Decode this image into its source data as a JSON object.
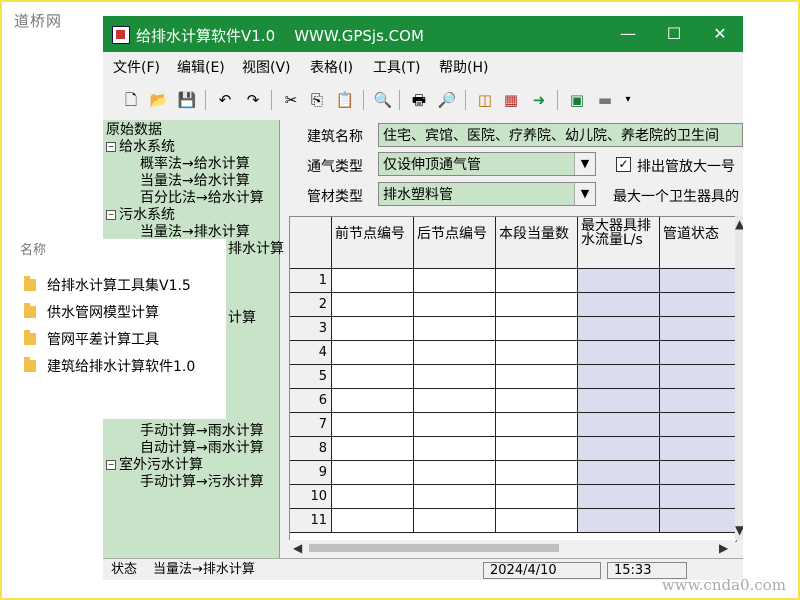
{
  "watermarks": {
    "top_left": "道桥网",
    "bottom_right": "www.cnda0.com"
  },
  "window": {
    "title": "给排水计算软件V1.0    WWW.GPSjs.COM",
    "minimize_glyph": "—",
    "maximize_glyph": "☐",
    "close_glyph": "✕"
  },
  "menu": [
    "文件(F)",
    "编辑(E)",
    "视图(V)",
    "表格(I)",
    "工具(T)",
    "帮助(H)"
  ],
  "toolbar": [
    {
      "icon": "new-file-icon",
      "glyph": "🗋"
    },
    {
      "icon": "open-folder-icon",
      "glyph": "📂"
    },
    {
      "icon": "save-icon",
      "glyph": "💾"
    },
    {
      "icon": "undo-icon",
      "glyph": "↶"
    },
    {
      "icon": "redo-icon",
      "glyph": "↷"
    },
    {
      "icon": "cut-icon",
      "glyph": "✂"
    },
    {
      "icon": "copy-icon",
      "glyph": "⎘"
    },
    {
      "icon": "paste-icon",
      "glyph": "📋"
    },
    {
      "icon": "find-icon",
      "glyph": "🔍"
    },
    {
      "icon": "print-icon",
      "glyph": "🖶"
    },
    {
      "icon": "print-preview-icon",
      "glyph": "🔎"
    },
    {
      "icon": "tag-icon",
      "glyph": "◫"
    },
    {
      "icon": "grid-icon",
      "glyph": "▦"
    },
    {
      "icon": "arrow-right-icon",
      "glyph": "➜"
    },
    {
      "icon": "excel-icon",
      "glyph": "▣"
    },
    {
      "icon": "export-icon",
      "glyph": "▬"
    }
  ],
  "tree": {
    "root": "原始数据",
    "visible_nodes": [
      {
        "label": "给水系统",
        "kind": "group"
      },
      {
        "label": "概率法→给水计算",
        "kind": "leaf"
      },
      {
        "label": "当量法→给水计算",
        "kind": "leaf"
      },
      {
        "label": "百分比法→给水计算",
        "kind": "leaf"
      },
      {
        "label": "污水系统",
        "kind": "group"
      },
      {
        "label": "当量法→排水计算",
        "kind": "leaf"
      },
      {
        "label": "排水计算",
        "kind": "leaf"
      },
      {
        "label": "计算",
        "kind": "leaf"
      },
      {
        "label": "手动计算→雨水计算",
        "kind": "leaf"
      },
      {
        "label": "自动计算→雨水计算",
        "kind": "leaf"
      },
      {
        "label": "室外污水计算",
        "kind": "group"
      },
      {
        "label": "手动计算→污水计算",
        "kind": "leaf"
      }
    ]
  },
  "props": {
    "building_label": "建筑名称",
    "building_value": "住宅、宾馆、医院、疗养院、幼儿院、养老院的卫生间",
    "vent_label": "通气类型",
    "vent_value": "仅设伸顶通气管",
    "vent_checkbox_label": "排出管放大一号",
    "vent_checkbox_checked": true,
    "pipe_label": "管材类型",
    "pipe_value": "排水塑料管",
    "pipe_note": "最大一个卫生器具的"
  },
  "grid": {
    "columns": [
      "前节点编号",
      "后节点编号",
      "本段当量数",
      "最大器具排水流量L/s",
      "管道状态"
    ],
    "shaded_columns": [
      3,
      4
    ],
    "rows": [
      1,
      2,
      3,
      4,
      5,
      6,
      7,
      8,
      9,
      10,
      11
    ]
  },
  "statusbar": {
    "label": "状态",
    "mode": "当量法→排水计算",
    "date": "2024/4/10",
    "time": "15:33"
  },
  "popup": {
    "header": "名称",
    "items": [
      "给排水计算工具集V1.5",
      "供水管网模型计算",
      "管网平差计算工具",
      "建筑给排水计算软件1.0"
    ]
  },
  "colors": {
    "title_bar": "#1a8c3a",
    "tree_bg": "#c9e3c9",
    "shaded_cell": "#dcdcef",
    "frame": "#f5e34a"
  }
}
